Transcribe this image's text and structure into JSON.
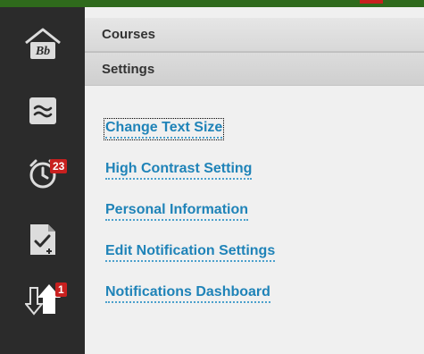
{
  "colors": {
    "sidebar_bg": "#2b2b2b",
    "accent_green": "#2f6a1c",
    "badge_red": "#c8201f",
    "link_blue": "#1f83b8"
  },
  "sidebar": {
    "items": [
      {
        "name": "home",
        "icon": "blackboard-home-icon",
        "logo_text": "Bb"
      },
      {
        "name": "activity-stream",
        "icon": "activity-stream-icon"
      },
      {
        "name": "calendar-alerts",
        "icon": "alarm-clock-icon",
        "badge": "23"
      },
      {
        "name": "grades",
        "icon": "grades-document-icon"
      },
      {
        "name": "notifications",
        "icon": "notification-arrows-icon",
        "badge": "1"
      }
    ]
  },
  "panel": {
    "sections": [
      {
        "label": "Courses"
      },
      {
        "label": "Settings"
      }
    ],
    "links": [
      {
        "label": "Change Text Size"
      },
      {
        "label": "High Contrast Setting"
      },
      {
        "label": "Personal Information"
      },
      {
        "label": "Edit Notification Settings"
      },
      {
        "label": "Notifications Dashboard"
      }
    ]
  }
}
